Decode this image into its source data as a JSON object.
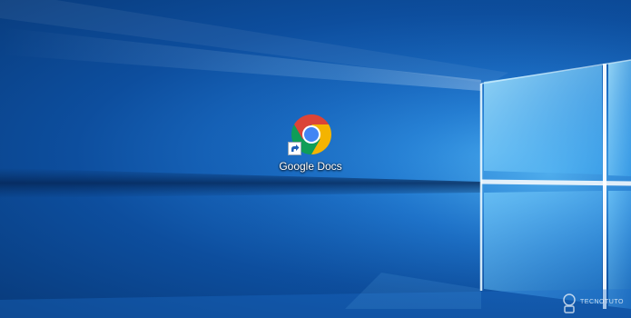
{
  "desktop": {
    "shortcut": {
      "label": "Google Docs",
      "icon": "chrome-icon",
      "overlay_icon": "shortcut-arrow-icon"
    },
    "watermark": {
      "text": "TECNOTUTO"
    }
  },
  "colors": {
    "background_dark": "#083a7a",
    "background_mid": "#1a6cc4",
    "light_beam": "#9fe0ff",
    "chrome_red": "#db4437",
    "chrome_yellow": "#f4b400",
    "chrome_green": "#0f9d58",
    "chrome_blue": "#4285f4"
  }
}
